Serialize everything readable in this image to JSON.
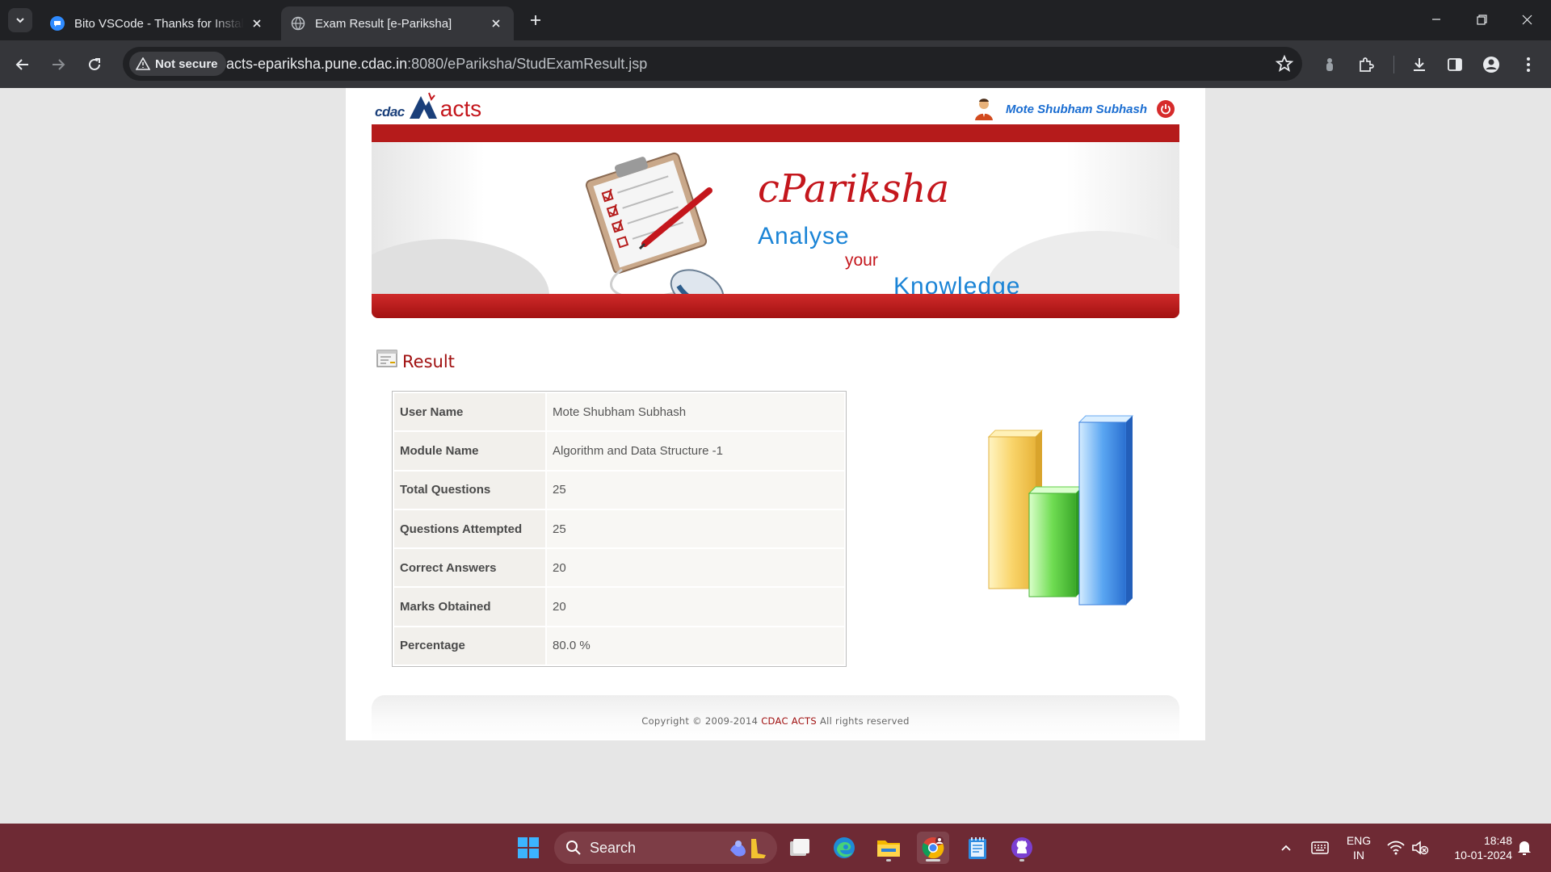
{
  "browser": {
    "tabs": [
      {
        "title": "Bito VSCode - Thanks for Installing",
        "active": false
      },
      {
        "title": "Exam Result [e-Pariksha]",
        "active": true
      }
    ],
    "security_label": "Not secure",
    "url_host": "acts-epariksha.pune.cdac.in",
    "url_path": ":8080/ePariksha/StudExamResult.jsp"
  },
  "header": {
    "logo_left": "cdac",
    "logo_right": "acts",
    "user_name": "Mote Shubham Subhash"
  },
  "banner": {
    "title": "cPariksha",
    "line1": "Analyse",
    "line2": "your",
    "line3": "Knowledge"
  },
  "result": {
    "heading": "Result",
    "rows": [
      {
        "label": "User Name",
        "value": "Mote Shubham Subhash"
      },
      {
        "label": "Module Name",
        "value": "Algorithm and Data Structure -1"
      },
      {
        "label": "Total Questions",
        "value": "25"
      },
      {
        "label": "Questions Attempted",
        "value": "25"
      },
      {
        "label": "Correct Answers",
        "value": "20"
      },
      {
        "label": "Marks Obtained",
        "value": "20"
      },
      {
        "label": "Percentage",
        "value": "80.0 %"
      }
    ]
  },
  "footer": {
    "copyright": "Copyright © 2009-2014",
    "org": "CDAC ACTS",
    "rights": "All rights reserved"
  },
  "taskbar": {
    "search_label": "Search",
    "lang_line1": "ENG",
    "lang_line2": "IN",
    "time": "18:48",
    "date": "10-01-2024"
  },
  "colors": {
    "brand_red": "#b51b1b",
    "brand_blue": "#1b84d6",
    "taskbar": "#6e2a34"
  }
}
